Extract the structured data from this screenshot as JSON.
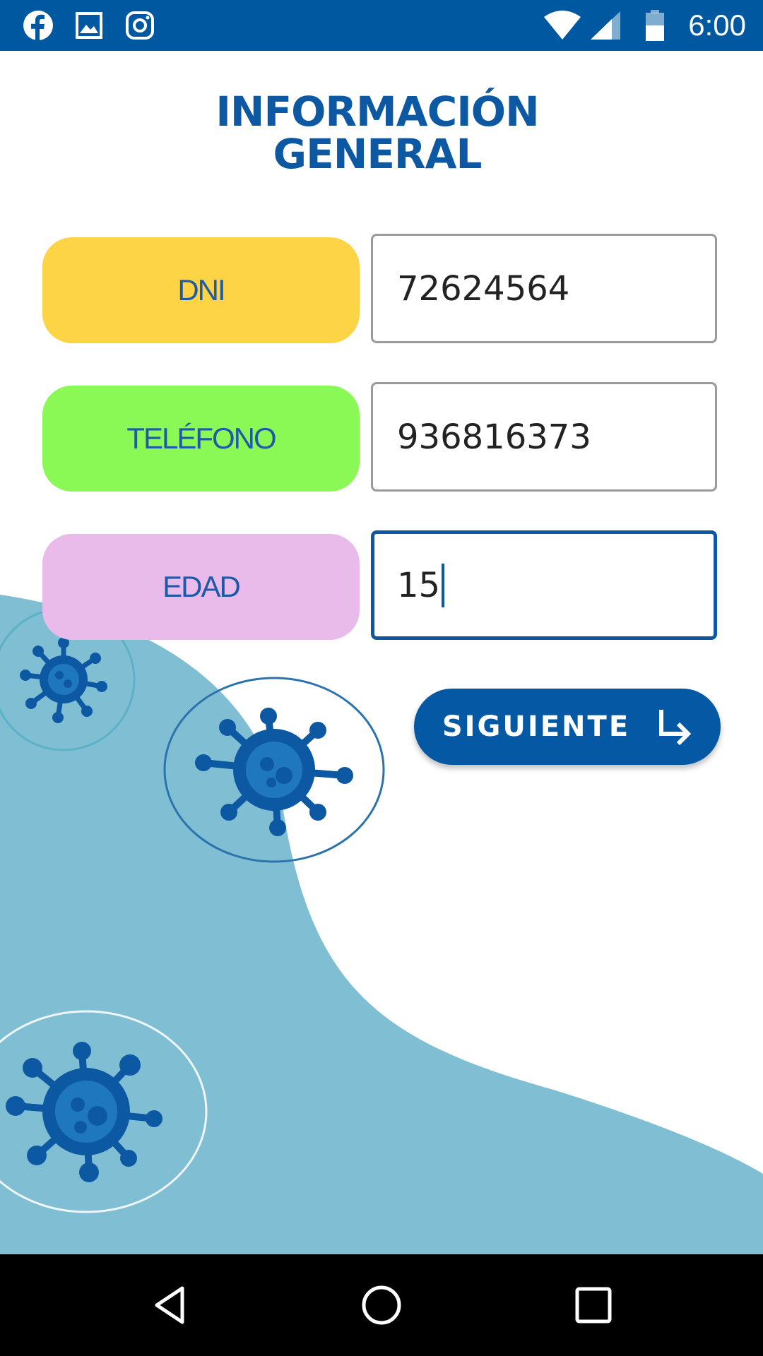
{
  "status_bar": {
    "time": "6:00",
    "left_icons": [
      "facebook-icon",
      "image-icon",
      "instagram-icon"
    ],
    "right_icons": [
      "wifi-icon",
      "signal-icon",
      "battery-icon"
    ],
    "color": "#0059a0"
  },
  "title": {
    "line1": "INFORMACIÓN",
    "line2": "GENERAL"
  },
  "form": {
    "dni": {
      "label": "DNI",
      "value": "72624564",
      "color": "#fdd446"
    },
    "telefono": {
      "label": "TELÉFONO",
      "value": "936816373",
      "color": "#8af855"
    },
    "edad": {
      "label": "EDAD",
      "value": "15",
      "color": "#e8bbeb"
    }
  },
  "next_button": {
    "label": "SIGUIENTE",
    "icon": "turn-right-arrow-icon"
  },
  "nav_bar": {
    "icons": [
      "back-icon",
      "home-icon",
      "recents-icon"
    ]
  },
  "colors": {
    "brand_blue": "#0c58a3",
    "wave": "#80bfd3"
  }
}
